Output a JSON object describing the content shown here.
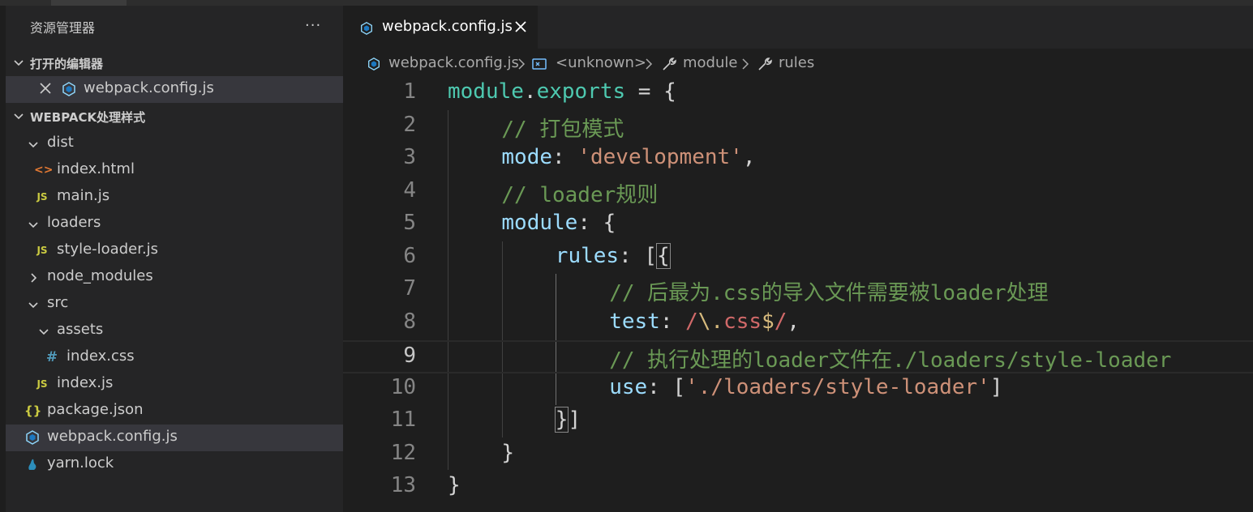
{
  "sidebar": {
    "title": "资源管理器",
    "more_label": "···",
    "open_editors": {
      "header": "打开的编辑器",
      "items": [
        {
          "label": "webpack.config.js",
          "icon": "webpack-icon"
        }
      ]
    },
    "project": {
      "header": "WEBPACK处理样式",
      "tree": [
        {
          "label": "dist",
          "type": "folder",
          "expanded": true,
          "icon": "chevron-down-icon"
        },
        {
          "label": "index.html",
          "type": "file",
          "icon": "html-icon",
          "glyph": "<>"
        },
        {
          "label": "main.js",
          "type": "file",
          "icon": "js-icon",
          "glyph": "JS"
        },
        {
          "label": "loaders",
          "type": "folder",
          "expanded": true,
          "icon": "chevron-down-icon"
        },
        {
          "label": "style-loader.js",
          "type": "file",
          "icon": "js-icon",
          "glyph": "JS"
        },
        {
          "label": "node_modules",
          "type": "folder",
          "expanded": false,
          "icon": "chevron-right-icon"
        },
        {
          "label": "src",
          "type": "folder",
          "expanded": true,
          "icon": "chevron-down-icon"
        },
        {
          "label": "assets",
          "type": "folder",
          "expanded": true,
          "icon": "chevron-down-icon"
        },
        {
          "label": "index.css",
          "type": "file",
          "icon": "css-icon",
          "glyph": "#"
        },
        {
          "label": "index.js",
          "type": "file",
          "icon": "js-icon",
          "glyph": "JS"
        },
        {
          "label": "package.json",
          "type": "file",
          "icon": "json-icon",
          "glyph": "{}"
        },
        {
          "label": "webpack.config.js",
          "type": "file",
          "icon": "webpack-icon",
          "selected": true
        },
        {
          "label": "yarn.lock",
          "type": "file",
          "icon": "yarn-icon"
        }
      ]
    }
  },
  "tab": {
    "label": "webpack.config.js",
    "icon": "webpack-icon",
    "close_icon": "close-icon"
  },
  "breadcrumb": {
    "file": "webpack.config.js",
    "unknown": "<unknown>",
    "module": "module",
    "rules": "rules"
  },
  "editor": {
    "current_line": 9,
    "lines": [
      {
        "n": "1",
        "tokens": [
          {
            "t": "module",
            "c": "var"
          },
          {
            "t": ".",
            "c": "op"
          },
          {
            "t": "exports",
            "c": "var"
          },
          {
            "t": " = {",
            "c": "op"
          }
        ]
      },
      {
        "n": "2",
        "tokens": [
          {
            "t": "// 打包模式",
            "c": "com"
          }
        ]
      },
      {
        "n": "3",
        "tokens": [
          {
            "t": "mode",
            "c": "prop"
          },
          {
            "t": ": ",
            "c": "op"
          },
          {
            "t": "'development'",
            "c": "str"
          },
          {
            "t": ",",
            "c": "op"
          }
        ]
      },
      {
        "n": "4",
        "tokens": [
          {
            "t": "// loader规则",
            "c": "com"
          }
        ]
      },
      {
        "n": "5",
        "tokens": [
          {
            "t": "module",
            "c": "prop"
          },
          {
            "t": ": {",
            "c": "op"
          }
        ]
      },
      {
        "n": "6",
        "tokens": [
          {
            "t": "rules",
            "c": "prop"
          },
          {
            "t": ": [",
            "c": "op"
          },
          {
            "t": "{",
            "c": "brk"
          }
        ]
      },
      {
        "n": "7",
        "tokens": [
          {
            "t": "// 后最为.css的导入文件需要被loader处理",
            "c": "com"
          }
        ]
      },
      {
        "n": "8",
        "tokens": [
          {
            "t": "test",
            "c": "prop"
          },
          {
            "t": ": ",
            "c": "op"
          },
          {
            "t": "/",
            "c": "re"
          },
          {
            "t": "\\.",
            "c": "rex"
          },
          {
            "t": "css",
            "c": "re"
          },
          {
            "t": "$",
            "c": "rex"
          },
          {
            "t": "/",
            "c": "re"
          },
          {
            "t": ",",
            "c": "op"
          }
        ]
      },
      {
        "n": "9",
        "tokens": [
          {
            "t": "// 执行处理的loader文件在./loaders/style-loader",
            "c": "com"
          }
        ]
      },
      {
        "n": "10",
        "tokens": [
          {
            "t": "use",
            "c": "prop"
          },
          {
            "t": ": [",
            "c": "op"
          },
          {
            "t": "'./loaders/style-loader'",
            "c": "str"
          },
          {
            "t": "]",
            "c": "op"
          }
        ]
      },
      {
        "n": "11",
        "tokens": [
          {
            "t": "}",
            "c": "brk"
          },
          {
            "t": "]",
            "c": "op"
          }
        ]
      },
      {
        "n": "12",
        "tokens": [
          {
            "t": "}",
            "c": "op"
          }
        ]
      },
      {
        "n": "13",
        "tokens": [
          {
            "t": "}",
            "c": "op"
          }
        ]
      }
    ]
  },
  "colors": {
    "sidebar_bg": "#252526",
    "editor_bg": "#1e1e1e",
    "selected_row": "#37373d",
    "webpack_blue": "#8ed6fb",
    "comment": "#6a9955",
    "string": "#ce9178",
    "property": "#9cdcfe"
  }
}
